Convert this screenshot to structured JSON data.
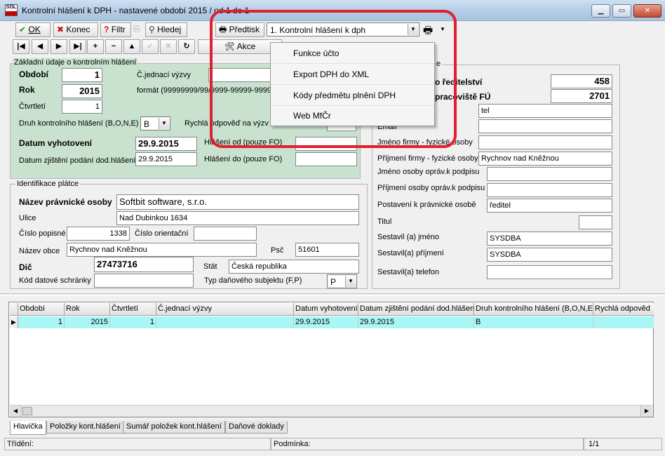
{
  "window": {
    "title": "Kontrolní hlášení k DPH - nastavené období 2015 / od 1 do 1",
    "logo_text": "SOL"
  },
  "toolbar": {
    "ok_label": "OK",
    "konec_label": "Konec",
    "filtr_label": "Filtr",
    "hledej_label": "Hledej",
    "predtisk_label": "Předtisk",
    "report_select": "1. Kontrolní hlášení k dph",
    "akce_label": "Akce"
  },
  "menu": {
    "items": [
      "Funkce účto",
      "Export DPH do XML",
      "Kódy předmětu plnění DPH",
      "Web MfČr"
    ]
  },
  "basic": {
    "group_title": "Základní údaje o kontrolním hlášení",
    "obdobi_label": "Období",
    "obdobi_value": "1",
    "rok_label": "Rok",
    "rok_value": "2015",
    "ctvrtleti_label": "Čtvrtletí",
    "ctvrtleti_value": "1",
    "cj_label": "Č.jednací výzvy",
    "format_label": "formát (99999999/99/9999-99999-9999",
    "druh_label": "Druh kontrolního hlášení (B,O,N,E)",
    "druh_value": "B",
    "rychla_label": "Rychlá odpověď na výzv",
    "datum_vyh_label": "Datum vyhotovení",
    "datum_vyh_value": "29.9.2015",
    "datum_zj_label": "Datum zjištění podání dod.hlášení",
    "datum_zj_value": "29.9.2015",
    "hlaseni_od_label": "Hlášení od (pouze FO)",
    "hlaseni_do_label": "Hlášení do (pouze FO)"
  },
  "payer": {
    "group_title": "Identifikace plátce",
    "nazev_label": "Název právnické osoby",
    "nazev_value": "Softbit software, s.r.o.",
    "ulice_label": "Ulice",
    "ulice_value": "Nad Dubinkou 1634",
    "cp_label": "Číslo popisné",
    "cp_value": "1338",
    "co_label": "Číslo orientační",
    "obec_label": "Název obce",
    "obec_value": "Rychnov nad Kněžnou",
    "psc_label": "Psč",
    "psc_value": "51601",
    "dic_label": "Dič",
    "dic_value": "27473716",
    "stat_label": "Stát",
    "stat_value": "Česká republika",
    "datova_label": "Kód datové schránky",
    "typ_label": "Typ daňového subjektu (F,P)",
    "typ_value": "P"
  },
  "right": {
    "group_title": "e",
    "reditelstvi_label": "o ředitelství",
    "reditelstvi_value": "458",
    "pracoviste_label": "pracoviště FÚ",
    "pracoviste_value": "2701",
    "tel_value": "tel",
    "email_label": "Email",
    "jmeno_firmy_label": "Jméno firmy - fyzické osoby",
    "prijmeni_firmy_label": "Příjmení firmy - fyzické osoby",
    "prijmeni_firmy_value": "Rychnov nad Kněžnou",
    "jmeno_opr_label": "Jméno osoby opráv.k podpisu",
    "prijmeni_opr_label": "Příjmení osoby opráv.k podpisu",
    "postaveni_label": "Postavení  k právnické osobě",
    "postaveni_value": "ředitel",
    "titul_label": "Titul",
    "sest_jmeno_label": "Sestavil (a) jméno",
    "sest_jmeno_value": "SYSDBA",
    "sest_prijmeni_label": "Sestavil(a) příjmení",
    "sest_prijmeni_value": "SYSDBA",
    "sest_tel_label": "Sestavil(a) telefon"
  },
  "grid": {
    "columns": [
      "Období",
      "Rok",
      "Čtvrtletí",
      "Č.jednací výzvy",
      "Datum vyhotovení",
      "Datum zjištění podání dod.hlášení",
      "Druh kontrolního hlášení (B,O,N,E)",
      "Rychlá odpověd"
    ],
    "rows": [
      [
        "1",
        "2015",
        "1",
        "",
        "29.9.2015",
        "29.9.2015",
        "B",
        ""
      ]
    ]
  },
  "tabs": [
    "Hlavička",
    "Položky kont.hlášení",
    "Sumář položek kont.hlášení",
    "Daňové doklady"
  ],
  "status": {
    "trideni_label": "Třídění:",
    "podminka_label": "Podmínka:",
    "page_info": "1/1"
  },
  "colors": {
    "form_green": "#c9e2cf",
    "selected_row": "#aaf5f5",
    "highlight_red": "#e02030"
  }
}
